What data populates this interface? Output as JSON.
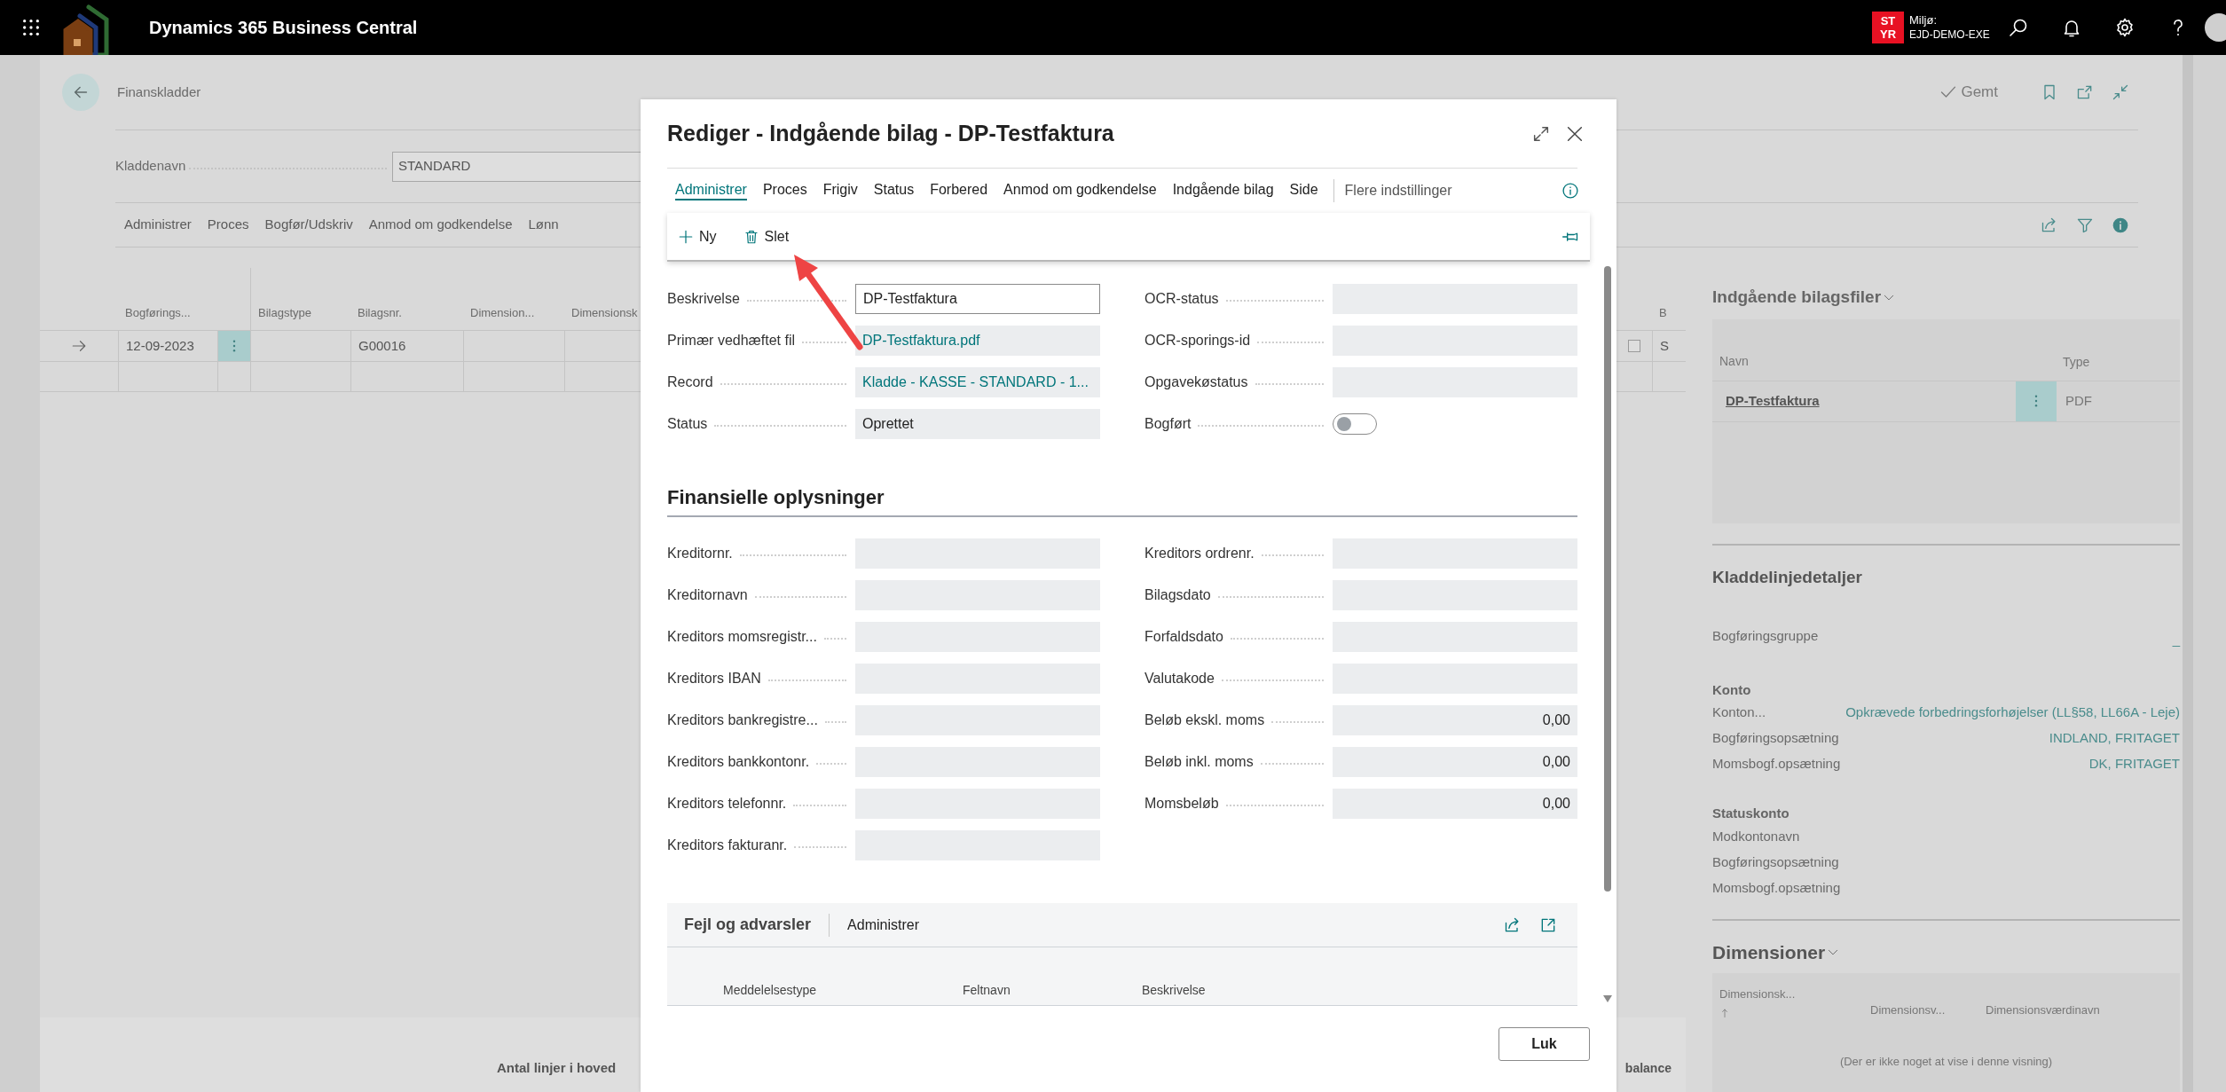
{
  "app_bar": {
    "title": "Dynamics 365 Business Central",
    "environment_badge": "ST YR",
    "environment_label": "Miljø:",
    "environment_name": "EJD-DEMO-EXE"
  },
  "page": {
    "breadcrumb": "Finanskladder",
    "save_status": "Gemt",
    "batch_name": {
      "label": "Kladdenavn",
      "value": "STANDARD"
    },
    "actions": [
      "Administrer",
      "Proces",
      "Bogfør/Udskriv",
      "Anmod om godkendelse",
      "Lønn"
    ],
    "columns": [
      "Bogførings...",
      "Bilagstype",
      "Bilagsnr.",
      "Dimension...",
      "Dimensionsk",
      "B"
    ],
    "rows": [
      {
        "selected": true,
        "posting_date": "12-09-2023",
        "document_no": "G00016",
        "checked": false,
        "column_b": "S"
      },
      {
        "selected": false
      }
    ],
    "footer": [
      "Antal linjer i hoved",
      "balance"
    ]
  },
  "factbox": {
    "files": {
      "title": "Indgående bilagsfiler",
      "columns": [
        "Navn",
        "Type"
      ],
      "rows": [
        {
          "name": "DP-Testfaktura",
          "type": "PDF"
        }
      ]
    },
    "details": {
      "title": "Kladdelinjedetaljer",
      "posting_group": {
        "label": "Bogføringsgruppe",
        "value": "_"
      },
      "groups": [
        {
          "heading": "Konto",
          "rows": [
            {
              "label": "Konton...",
              "value": "Opkrævede forbedringsforhøjelser (LL§58, LL66A - Leje)"
            },
            {
              "label": "Bogføringsopsætning",
              "value": "INDLAND, FRITAGET"
            },
            {
              "label": "Momsbogf.opsætning",
              "value": "DK, FRITAGET"
            }
          ]
        },
        {
          "heading": "Statuskonto",
          "rows": [
            {
              "label": "Modkontonavn"
            },
            {
              "label": "Bogføringsopsætning"
            },
            {
              "label": "Momsbogf.opsætning"
            }
          ]
        }
      ]
    },
    "dimensions": {
      "title": "Dimensioner",
      "columns": [
        "Dimensionsk...",
        "Dimensionsv...",
        "Dimensionsværdinavn"
      ],
      "empty_text": "(Der er ikke noget at vise i denne visning)"
    }
  },
  "dialog": {
    "title": "Rediger - Indgående bilag - DP-Testfaktura",
    "tabs": [
      {
        "label": "Administrer",
        "selected": true
      },
      {
        "label": "Proces",
        "selected": false
      },
      {
        "label": "Frigiv",
        "selected": false
      },
      {
        "label": "Status",
        "selected": false
      },
      {
        "label": "Forbered",
        "selected": false
      },
      {
        "label": "Anmod om godkendelse",
        "selected": false
      },
      {
        "label": "Indgående bilag",
        "selected": false
      },
      {
        "label": "Side",
        "selected": false
      }
    ],
    "more_tab": "Flere indstillinger",
    "actions": [
      {
        "label": "Ny",
        "kind": "new"
      },
      {
        "label": "Slet",
        "kind": "delete"
      }
    ],
    "fields_left": [
      {
        "label": "Beskrivelse",
        "value": "DP-Testfaktura",
        "kind": "editable"
      },
      {
        "label": "Primær vedhæftet fil",
        "value": "DP-Testfaktura.pdf",
        "kind": "link"
      },
      {
        "label": "Record",
        "value": "Kladde - KASSE - STANDARD - 1...",
        "kind": "link"
      },
      {
        "label": "Status",
        "value": "Oprettet",
        "kind": "text"
      }
    ],
    "fields_right": [
      {
        "label": "OCR-status",
        "kind": "text"
      },
      {
        "label": "OCR-sporings-id",
        "kind": "text"
      },
      {
        "label": "Opgavekøstatus",
        "kind": "text"
      },
      {
        "label": "Bogført",
        "kind": "toggle",
        "on": false
      }
    ],
    "financial": {
      "title": "Finansielle oplysninger",
      "fields_left": [
        {
          "label": "Kreditornr.",
          "kind": "text"
        },
        {
          "label": "Kreditornavn",
          "kind": "text"
        },
        {
          "label": "Kreditors momsregistr...",
          "kind": "text"
        },
        {
          "label": "Kreditors IBAN",
          "kind": "text"
        },
        {
          "label": "Kreditors bankregistre...",
          "kind": "text"
        },
        {
          "label": "Kreditors bankkontonr.",
          "kind": "text"
        },
        {
          "label": "Kreditors telefonnr.",
          "kind": "text"
        },
        {
          "label": "Kreditors fakturanr.",
          "kind": "text"
        }
      ],
      "fields_right": [
        {
          "label": "Kreditors ordrenr.",
          "kind": "text"
        },
        {
          "label": "Bilagsdato",
          "kind": "text"
        },
        {
          "label": "Forfaldsdato",
          "kind": "text"
        },
        {
          "label": "Valutakode",
          "kind": "text"
        },
        {
          "label": "Beløb ekskl. moms",
          "value": "0,00",
          "kind": "amount"
        },
        {
          "label": "Beløb inkl. moms",
          "value": "0,00",
          "kind": "amount"
        },
        {
          "label": "Momsbeløb",
          "value": "0,00",
          "kind": "amount"
        }
      ]
    },
    "errors_part": {
      "title": "Fejl og advarsler",
      "action": "Administrer",
      "columns": [
        "Meddelelsestype",
        "Feltnavn",
        "Beskrivelse"
      ]
    },
    "close_button": "Luk"
  }
}
